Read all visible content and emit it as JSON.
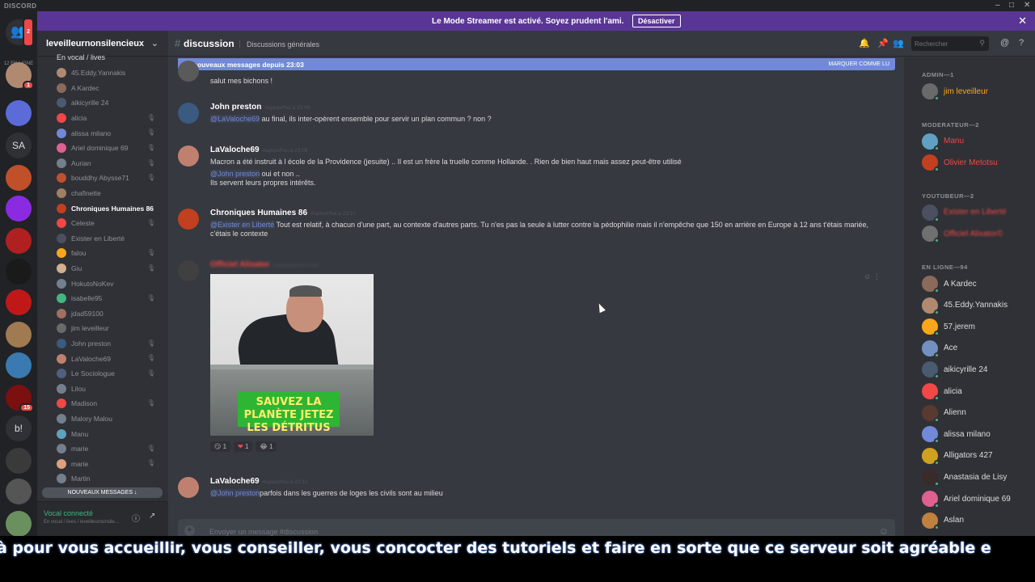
{
  "window": {
    "brand": "DISCORD",
    "controls": [
      "–",
      "□",
      "✕"
    ]
  },
  "guilds": {
    "online_label": "12 EN LIGNE",
    "home_badge": "2",
    "items": [
      {
        "color": "#b08a70",
        "badge": "1"
      },
      {
        "color": "#5b6bd8",
        "badge": ""
      },
      {
        "color": "#2f3136",
        "text": "SA",
        "badge": ""
      },
      {
        "color": "#c0502a",
        "badge": ""
      },
      {
        "color": "#8a2be2",
        "badge": ""
      },
      {
        "color": "#b02020",
        "badge": ""
      },
      {
        "color": "#1a1a1a",
        "badge": ""
      },
      {
        "color": "#c01818",
        "badge": ""
      },
      {
        "color": "#a07a50",
        "badge": ""
      },
      {
        "color": "#3a7ab0",
        "badge": ""
      },
      {
        "color": "#7a1010",
        "badge": "15"
      },
      {
        "color": "#2f3136",
        "text": "b!",
        "badge": ""
      },
      {
        "color": "#3a3a3a",
        "badge": ""
      },
      {
        "color": "#555555",
        "badge": ""
      },
      {
        "color": "#6a9060",
        "badge": ""
      }
    ]
  },
  "streamer_banner": {
    "text": "Le Mode Streamer est activé. Soyez prudent l'ami.",
    "button": "Désactiver",
    "close": "✕"
  },
  "server": {
    "name": "leveilleurnonsilencieux",
    "voice_channel": "En vocal / lives"
  },
  "voice_users": [
    {
      "name": "45.Eddy.Yannakis",
      "color": "#b08a70",
      "muted": false
    },
    {
      "name": "A Kardec",
      "color": "#8a6a5a",
      "muted": false
    },
    {
      "name": "aikicyrille 24",
      "color": "#4a5a70",
      "muted": false
    },
    {
      "name": "alicia",
      "color": "#f04747",
      "muted": true
    },
    {
      "name": "alissa milano",
      "color": "#7289da",
      "muted": true
    },
    {
      "name": "Ariel dominique 69",
      "color": "#e06090",
      "muted": true
    },
    {
      "name": "Aurian",
      "color": "#747f8d",
      "muted": true
    },
    {
      "name": "bouddhy Abysse71",
      "color": "#c05030",
      "muted": true
    },
    {
      "name": "chafinette",
      "color": "#a08060",
      "muted": false
    },
    {
      "name": "Chroniques Humaines 86",
      "color": "#c04020",
      "muted": false,
      "highlight": true
    },
    {
      "name": "Celeste",
      "color": "#f04747",
      "muted": true
    },
    {
      "name": "Exister en Liberté",
      "color": "#4a5060",
      "muted": false
    },
    {
      "name": "falou",
      "color": "#faa61a",
      "muted": true
    },
    {
      "name": "Giu",
      "color": "#d0b090",
      "muted": true
    },
    {
      "name": "HokutoNoKev",
      "color": "#747f8d",
      "muted": false
    },
    {
      "name": "isabelle95",
      "color": "#43b581",
      "muted": true
    },
    {
      "name": "jdad59100",
      "color": "#a07060",
      "muted": false
    },
    {
      "name": "jim leveilleur",
      "color": "#6a6a6a",
      "muted": false
    },
    {
      "name": "John preston",
      "color": "#3a5a80",
      "muted": true
    },
    {
      "name": "LaValoche69",
      "color": "#c08070",
      "muted": true
    },
    {
      "name": "Le Sociologue",
      "color": "#506080",
      "muted": true
    },
    {
      "name": "Lilou",
      "color": "#747f8d",
      "muted": false
    },
    {
      "name": "Madison",
      "color": "#f04747",
      "muted": true
    },
    {
      "name": "Malory Malou",
      "color": "#747f8d",
      "muted": false
    },
    {
      "name": "Manu",
      "color": "#60a0c0",
      "muted": false
    },
    {
      "name": "marie",
      "color": "#747f8d",
      "muted": true
    },
    {
      "name": "marie",
      "color": "#e0a080",
      "muted": true
    },
    {
      "name": "Martin",
      "color": "#747f8d",
      "muted": false
    }
  ],
  "new_messages_pill": "NOUVEAUX MESSAGES ↓",
  "voice_panel": {
    "status": "Vocal connecté",
    "sub": "En vocal / lives / leveilleurnonsile...",
    "icon1": "ⓘ",
    "icon2": "↗"
  },
  "chat_header": {
    "hash": "#",
    "channel": "discussion",
    "topic": "Discussions générales",
    "search_placeholder": "Rechercher",
    "icons": [
      "🔔",
      "📌",
      "👥",
      "@",
      "?"
    ]
  },
  "new_bar": {
    "text": "22 nouveaux messages depuis 23:03",
    "mark": "MARQUER COMME LU"
  },
  "messages": [
    {
      "author": "",
      "time": "",
      "avatar": "#5a5a5a",
      "body": "salut mes bichons !"
    },
    {
      "author": "John preston",
      "time": "Aujourd'hui à 23:08",
      "avatar": "#3a5a80",
      "mention": "@LaValoche69",
      "body": " au final, ils inter-opèrent ensemble pour servir un plan commun ? non ?"
    },
    {
      "author": "LaValoche69",
      "time": "Aujourd'hui à 23:09",
      "avatar": "#c08070",
      "body": "Macron a été instruit à l école de la Providence (jesuite) .. Il est un frère la truelle comme Hollande. .  Rien de bien haut mais assez peut-être utilisé",
      "mention2": "@John preston",
      "body2": " oui et non ..",
      "body3": "Ils servent leurs propres intérêts."
    },
    {
      "author": "Chroniques Humaines 86",
      "time": "Aujourd'hui à 23:10",
      "avatar": "#c04020",
      "mention": "@Exister en Liberté",
      "body": " Tout est relatif, à chacun d'une part, au contexte d'autres parts. Tu n'es pas la seule à lutter contre la pédophilie mais il n'empêche que 150 en arrière en Europe à 12 ans t'étais mariée, c'étais le contexte"
    },
    {
      "author": "Officiel Alixator",
      "time": "Aujourd'hui à 23:10",
      "avatar": "#404040",
      "image_caption": "SAUVEZ LA PLANÈTE JETEZ LES DÉTRITUS",
      "reactions": [
        {
          "emoji": "😏",
          "count": "1"
        },
        {
          "emoji": "❤",
          "count": "1"
        },
        {
          "emoji": "😂",
          "count": "1"
        }
      ]
    },
    {
      "author": "LaValoche69",
      "time": "Aujourd'hui à 23:10",
      "avatar": "#c08070",
      "mention": "@John preston",
      "body": "parfois dans les guerres de loges les civils sont au milieu"
    }
  ],
  "composer": {
    "placeholder": "Envoyer un message #discussion",
    "plus": "+",
    "emoji": "☺"
  },
  "members": {
    "categories": [
      {
        "label": "ADMIN—1",
        "items": [
          {
            "name": "jim leveilleur",
            "color": "#faa61a",
            "avatar": "#6a6a6a"
          }
        ]
      },
      {
        "label": "MODERATEUR—2",
        "items": [
          {
            "name": "Manu",
            "color": "#f04747",
            "avatar": "#60a0c0"
          },
          {
            "name": "Olivier Metotsu",
            "color": "#f04747",
            "avatar": "#c04020"
          }
        ]
      },
      {
        "label": "YOUTUBEUR—2",
        "items": [
          {
            "name": "Exister en Liberté",
            "color": "#f04747",
            "avatar": "#4a5060"
          },
          {
            "name": "Officiel Alixator©",
            "color": "#f04747",
            "avatar": "#707070"
          }
        ]
      },
      {
        "label": "EN LIGNE—94",
        "items": [
          {
            "name": "A Kardec",
            "color": "#dcddde",
            "avatar": "#8a6a5a"
          },
          {
            "name": "45.Eddy.Yannakis",
            "color": "#dcddde",
            "avatar": "#b08a70"
          },
          {
            "name": "57.jerem",
            "color": "#dcddde",
            "avatar": "#faa61a"
          },
          {
            "name": "Ace",
            "color": "#dcddde",
            "avatar": "#7290c0"
          },
          {
            "name": "aikicyrille 24",
            "color": "#dcddde",
            "avatar": "#4a5a70"
          },
          {
            "name": "alicia",
            "color": "#dcddde",
            "avatar": "#f04747"
          },
          {
            "name": "Alienn",
            "color": "#dcddde",
            "avatar": "#5a3a30"
          },
          {
            "name": "alissa milano",
            "color": "#dcddde",
            "avatar": "#7289da"
          },
          {
            "name": "Alligators 427",
            "color": "#dcddde",
            "avatar": "#d0a020"
          },
          {
            "name": "Anastasia de Lisy",
            "color": "#dcddde",
            "avatar": "#3a2a2a"
          },
          {
            "name": "Ariel dominique 69",
            "color": "#dcddde",
            "avatar": "#e06090"
          },
          {
            "name": "Aslan",
            "color": "#dcddde",
            "avatar": "#c08040"
          }
        ]
      }
    ]
  },
  "subtitle": "à pour vous accueillir, vous conseiller, vous concocter des tutoriels et faire en sorte que ce serveur soit agréable e"
}
